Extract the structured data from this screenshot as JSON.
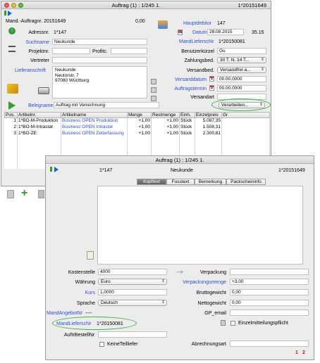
{
  "back_window": {
    "title": "Auftrag (1) : 1/245 1.",
    "order_id": "1*20151649",
    "mand_auftragsnr": "Mand.-Auftragnr. 20151649",
    "amount": "0,00",
    "adressnr_label": "Adressnr.",
    "adressnr_value": "1*147",
    "suchname_label": "Suchname",
    "suchname_value": "Neukunde",
    "projektnr_label": "Projektnr.",
    "profitc_label": "Profitc.",
    "vertreter_label": "Vertreter",
    "lieferanschrift_label": "Lieferanschrift",
    "address_lines": [
      "Neukunde",
      "Neutorstr. 7",
      "97080 Würzburg"
    ],
    "hauptdebitor_label": "Hauptdebitor",
    "hauptdebitor_value": "147",
    "datum_label": "Datum",
    "datum_value": "28.08.2015",
    "time_value": "35.15",
    "mandlieferschein_label": "MandLieferscNr",
    "mandlieferschein_value": "1*20150081",
    "benutzerkuerzel_label": "Benutzerkürzel",
    "benutzerkuerzel_value": "Gu",
    "zahlungsbed_label": "Zahlungsbed.",
    "zahlungsbed_value": "30 T. N. 14 T...",
    "versandbed_label": "Versandbed.",
    "versandbed_value": "Versandfrei a...",
    "versanddatum_label": "Versanddatum",
    "versanddatum_value": "00.00.0000",
    "auftragstermin_label": "Auftragstermin",
    "auftragstermin_value": "00.00.0000",
    "versandart_label": "Versandart",
    "belegname_label": "Belegname",
    "belegname_value": "Auftrag mit Verrechnung",
    "verarbeiten_label": "Verarbeiten..."
  },
  "table": {
    "headers": [
      "Pos.",
      "Artikelnr.",
      "Artikelname",
      "Menge",
      "Restmenge",
      "Einh.",
      "Einzelpreis",
      "Gr"
    ],
    "rows": [
      [
        "1",
        "1*BO-M-Produktion",
        "Business OPEN Produktion",
        "+1,00",
        "+1,00",
        "Stück",
        "5.087,35"
      ],
      [
        "2",
        "1*BO-M-Intrastat",
        "Business OPEN Intrastat",
        "+1,00",
        "+1,00",
        "Stück",
        "1.508,31"
      ],
      [
        "3",
        "1*BO-ZE",
        "Business OPEN Zeiterfassung",
        "+1,00",
        "+1,00",
        "Stück",
        "2.300,81"
      ]
    ]
  },
  "front_window": {
    "title": "Auftrag (1) : 1/245 1.",
    "customer_nr": "1*147",
    "customer_name": "Neukunde",
    "order_id": "1*20151649",
    "tabs": [
      "Kopftext",
      "Fusstext",
      "Bemerkung",
      "Packscheininfo"
    ],
    "kostenstelle_label": "Kostenstelle",
    "kostenstelle_value": "4000",
    "waehrung_label": "Währung",
    "waehrung_value": "Euro",
    "kurs_label": "Kurs",
    "kurs_value": "1,0000",
    "sprache_label": "Sprache",
    "sprache_value": "Deutsch",
    "mandangebotnr_label": "MandAngebotNr",
    "mandangebotnr_value": "----",
    "mandlieferschein_label": "MandLieferscNr",
    "mandlieferschein_value": "1*20150081",
    "auftrbestellnr_label": "AuftrBestellNr",
    "keineteillief_label": "KeineTeilliefer",
    "arrow_label": "-->",
    "verpackung_label": "Verpackung",
    "verpackungsmenge_label": "Verpackungsmenge",
    "verpackungsmenge_value": "+3,00",
    "bruttogewicht_label": "Bruttogewicht",
    "bruttogewicht_value": "0,00",
    "nettogewicht_label": "Nettogewicht",
    "nettogewicht_value": "0,00",
    "gp_email_label": "GP_email",
    "einzelmitteilung_label": "Einzelmitteilungspflicht",
    "abrechnungsart_label": "Abrechnungsart",
    "page1": "1",
    "page2": "2"
  }
}
